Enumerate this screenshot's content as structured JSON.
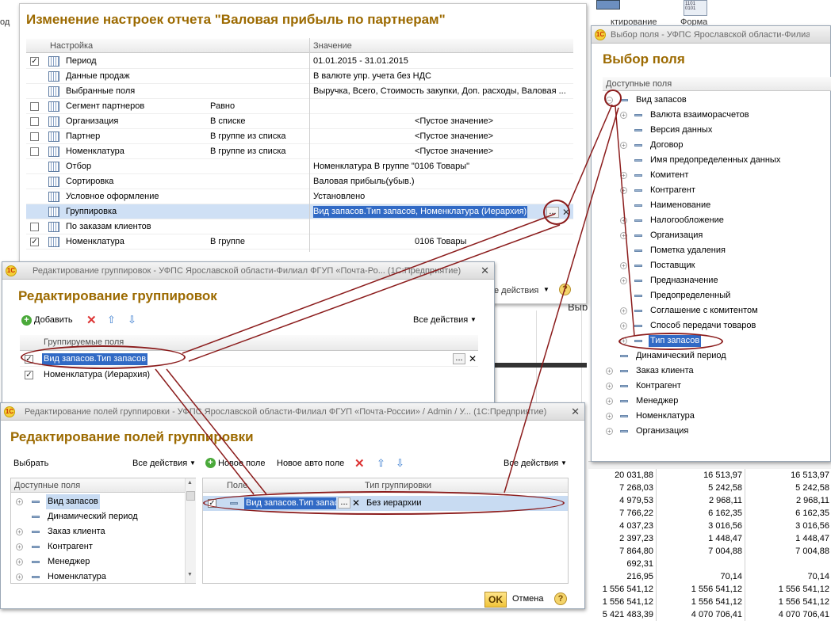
{
  "background": {
    "desktop_labels": [
      "ктирование",
      "Форма"
    ],
    "left_edge_label": "од",
    "behind_label": "Выр",
    "numbers": [
      [
        "20 031,88",
        "16 513,97",
        "16 513,97"
      ],
      [
        "7 268,03",
        "5 242,58",
        "5 242,58"
      ],
      [
        "4 979,53",
        "2 968,11",
        "2 968,11"
      ],
      [
        "7 766,22",
        "6 162,35",
        "6 162,35"
      ],
      [
        "4 037,23",
        "3 016,56",
        "3 016,56"
      ],
      [
        "2 397,23",
        "1 448,47",
        "1 448,47"
      ],
      [
        "7 864,80",
        "7 004,88",
        "7 004,88"
      ],
      [
        "692,31",
        "",
        ""
      ],
      [
        "216,95",
        "70,14",
        "70,14"
      ],
      [
        "1 556 541,12",
        "1 556 541,12",
        "1 556 541,12"
      ],
      [
        "1 556 541,12",
        "1 556 541,12",
        "1 556 541,12"
      ],
      [
        "5 421 483,39",
        "4 070 706,41",
        "4 070 706,41"
      ]
    ]
  },
  "settings_window": {
    "title": "Изменение настроек отчета \"Валовая прибыль по партнерам\"",
    "col_setting": "Настройка",
    "col_value": "Значение",
    "rows": [
      {
        "checked": true,
        "name": "Период",
        "cond": "",
        "value": "01.01.2015 - 31.01.2015"
      },
      {
        "checked": null,
        "name": "Данные продаж",
        "cond": "",
        "value": "В валюте упр. учета без НДС"
      },
      {
        "checked": null,
        "name": "Выбранные поля",
        "cond": "",
        "value": "Выручка, Всего, Стоимость закупки, Доп. расходы, Валовая ..."
      },
      {
        "checked": false,
        "name": "Сегмент партнеров",
        "cond": "Равно",
        "value": ""
      },
      {
        "checked": false,
        "name": "Организация",
        "cond": "В списке",
        "value": "<Пустое значение>"
      },
      {
        "checked": false,
        "name": "Партнер",
        "cond": "В группе из списка",
        "value": "<Пустое значение>"
      },
      {
        "checked": false,
        "name": "Номенклатура",
        "cond": "В группе из списка",
        "value": "<Пустое значение>"
      },
      {
        "checked": null,
        "name": "Отбор",
        "cond": "",
        "value": "Номенклатура В группе \"0106 Товары\""
      },
      {
        "checked": null,
        "name": "Сортировка",
        "cond": "",
        "value": "Валовая прибыль(убыв.)"
      },
      {
        "checked": null,
        "name": "Условное оформление",
        "cond": "",
        "value": "Установлено"
      },
      {
        "checked": null,
        "name": "Группировка",
        "cond": "",
        "value": "Вид запасов.Тип запасов, Номенклатура (Иерархия)"
      },
      {
        "checked": false,
        "name": "По заказам клиентов",
        "cond": "",
        "value": ""
      },
      {
        "checked": true,
        "name": "Номенклатура",
        "cond": "В группе",
        "value": "0106 Товары"
      }
    ],
    "all_actions": "е действия",
    "dots": "...",
    "clear": "✕"
  },
  "field_window": {
    "title": "Выбор поля - УФПС Ярославской области-Филиал",
    "heading": "Выбор поля",
    "col": "Доступные поля",
    "root": "Вид запасов",
    "children": [
      "Валюта взаиморасчетов",
      "Версия данных",
      "Договор",
      "Имя предопределенных данных",
      "Комитент",
      "Контрагент",
      "Наименование",
      "Налогообложение",
      "Организация",
      "Пометка удаления",
      "Поставщик",
      "Предназначение",
      "Предопределенный",
      "Соглашение с комитентом",
      "Способ передачи товаров",
      "Тип запасов"
    ],
    "children_plus": [
      true,
      false,
      true,
      false,
      true,
      true,
      false,
      true,
      true,
      false,
      true,
      true,
      false,
      true,
      true,
      true
    ],
    "others": [
      {
        "label": "Динамический период",
        "plus": false
      },
      {
        "label": "Заказ клиента",
        "plus": true
      },
      {
        "label": "Контрагент",
        "plus": true
      },
      {
        "label": "Менеджер",
        "plus": true
      },
      {
        "label": "Номенклатура",
        "plus": true
      },
      {
        "label": "Организация",
        "plus": true
      }
    ]
  },
  "groupings_window": {
    "title": "Редактирование группировок - УФПС Ярославской области-Филиал ФГУП «Почта-Ро... (1С:Предприятие)",
    "heading": "Редактирование группировок",
    "add": "Добавить",
    "all_actions": "Все действия",
    "col": "Группируемые поля",
    "rows": [
      {
        "checked": true,
        "label": "Вид запасов.Тип запасов"
      },
      {
        "checked": true,
        "label": "Номенклатура (Иерархия)"
      }
    ]
  },
  "grouping_fields_window": {
    "title": "Редактирование полей группировки - УФПС Ярославской области-Филиал ФГУП «Почта-России» / Admin / У... (1С:Предприятие)",
    "heading": "Редактирование полей группировки",
    "select": "Выбрать",
    "all_actions": "Все действия",
    "new_field": "Новое поле",
    "new_auto": "Новое авто поле",
    "left_col": "Доступные поля",
    "left_items": [
      {
        "label": "Вид запасов",
        "plus": true,
        "sel": true
      },
      {
        "label": "Динамический период",
        "plus": false
      },
      {
        "label": "Заказ клиента",
        "plus": true
      },
      {
        "label": "Контрагент",
        "plus": true
      },
      {
        "label": "Менеджер",
        "plus": true
      },
      {
        "label": "Номенклатура",
        "plus": true
      }
    ],
    "col_field": "Поле",
    "col_type": "Тип группировки",
    "row_field": "Вид запасов.Тип запас",
    "row_type": "Без иерархии",
    "ok": "OK",
    "cancel": "Отмена",
    "help": "?"
  }
}
